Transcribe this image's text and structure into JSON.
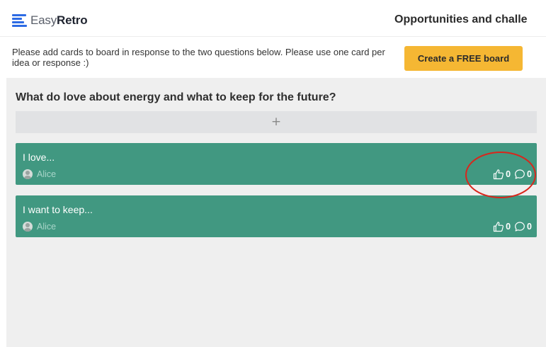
{
  "header": {
    "logo_easy": "Easy",
    "logo_retro": "Retro",
    "board_title": "Opportunities and challe"
  },
  "notice": {
    "text": "Please add cards to board in response to the two questions below. Please use one card per idea or response :)",
    "create_button": "Create a FREE board"
  },
  "column": {
    "title": "What do love about energy and what to keep for the future?",
    "add_card_label": "+",
    "cards": [
      {
        "text": "I love...",
        "author": "Alice",
        "votes": "0",
        "comments": "0"
      },
      {
        "text": "I want to keep...",
        "author": "Alice",
        "votes": "0",
        "comments": "0"
      }
    ]
  },
  "colors": {
    "brand_blue": "#2d6be4",
    "cta_yellow": "#f5b733",
    "card_green": "#419881",
    "annotation_red": "#d9261c"
  },
  "icons": [
    "logo-mark-icon",
    "avatar-icon",
    "thumbs-up-icon",
    "comment-bubble-icon"
  ],
  "annotation": "red ellipse circling the vote and comment counters of the first card"
}
